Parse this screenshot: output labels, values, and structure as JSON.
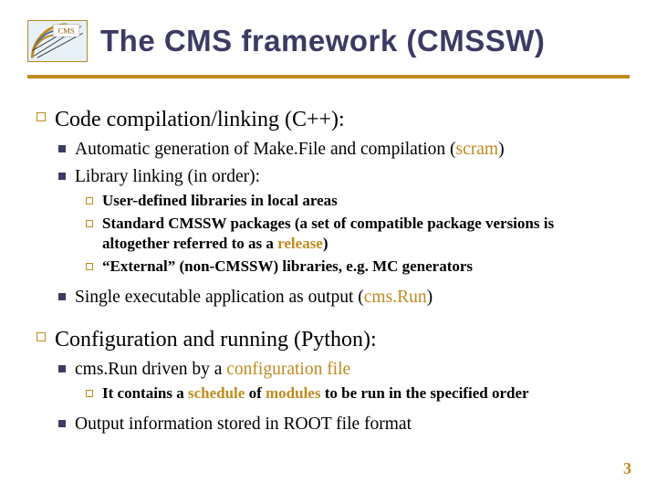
{
  "title": "The CMS framework (CMSSW)",
  "page_number": "3",
  "logo_label": "CMS",
  "s1": {
    "h": "Code compilation/linking (C++):",
    "a": {
      "pre": "Automatic generation of Make.File and compilation (",
      "hl": "scram",
      "post": ")"
    },
    "b": "Library linking (in order):",
    "b1": "User-defined libraries in local areas",
    "b2": {
      "pre": "Standard CMSSW packages (a set of compatible package versions is altogether referred to as a ",
      "hl": "release",
      "post": ")"
    },
    "b3": "“External” (non-CMSSW) libraries, e.g. MC generators",
    "c": {
      "pre": "Single executable application as output (",
      "hl": "cms.Run",
      "post": ")"
    }
  },
  "s2": {
    "h": "Configuration and running (Python):",
    "a": {
      "pre": "cms.Run driven by a ",
      "hl": "configuration file"
    },
    "a1": {
      "pre": "It contains a ",
      "hl1": "schedule",
      "mid": " of ",
      "hl2": "modules",
      "post": " to be run in the specified order"
    },
    "b": "Output information stored in ROOT file format"
  }
}
